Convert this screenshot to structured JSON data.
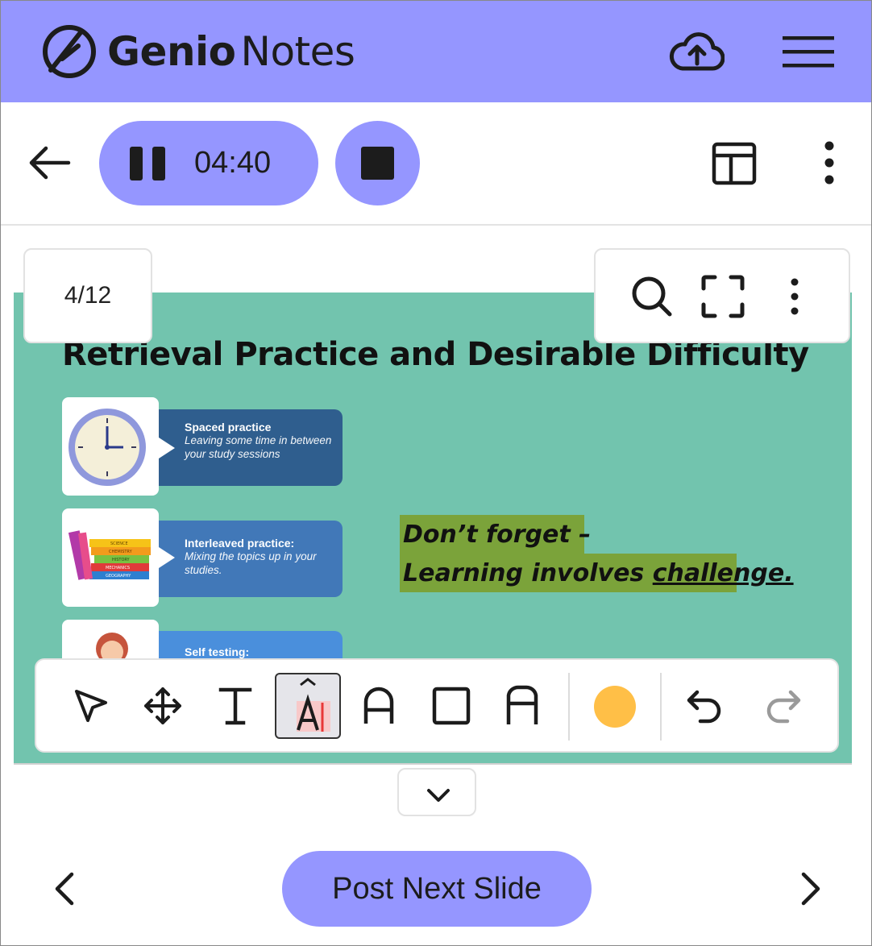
{
  "header": {
    "brand_bold": "Genio",
    "brand_light": "Notes",
    "icons": [
      "genio-logo-icon",
      "cloud-upload-icon",
      "hamburger-menu-icon"
    ],
    "color": "#9596ff"
  },
  "recording": {
    "elapsed": "04:40",
    "icons": [
      "back-arrow-icon",
      "pause-icon",
      "stop-icon",
      "layout-icon",
      "more-vertical-icon"
    ]
  },
  "viewer": {
    "page_counter": "4/12",
    "tools": [
      "search-icon",
      "fullscreen-icon",
      "more-vertical-icon"
    ]
  },
  "slide": {
    "title": "Retrieval Practice and Desirable Difficulty",
    "cards": [
      {
        "title": "Spaced practice",
        "desc": "Leaving some time in between your study sessions",
        "color": "#2f5e8e"
      },
      {
        "title": "Interleaved practice:",
        "desc": "Mixing the topics up in your studies.",
        "color": "#4178b8"
      },
      {
        "title": "Self testing:",
        "desc": "",
        "color": "#4a8fdc"
      }
    ],
    "book_labels": [
      "SCIENCE",
      "CHEMISTRY",
      "HISTORY",
      "MECHANICS",
      "GEOGRAPHY"
    ],
    "callout_line1": "Don’t forget –",
    "callout_line2_a": "Learning involves ",
    "callout_line2_b": "challenge.",
    "background": "#72c4ae",
    "highlight_color": "#7ba33a"
  },
  "annotation_toolbar": {
    "tools": [
      "select-pointer-icon",
      "move-icon",
      "text-icon",
      "text-highlight-icon",
      "text-style-icon",
      "rectangle-icon",
      "shape-text-icon"
    ],
    "active_tool": "text-highlight-icon",
    "pen_color": "#ffbf47",
    "actions": [
      "undo-icon",
      "redo-icon"
    ]
  },
  "footer": {
    "post_label": "Post Next Slide",
    "icons": [
      "chevron-left-icon",
      "chevron-right-icon",
      "chevron-down-icon"
    ]
  }
}
